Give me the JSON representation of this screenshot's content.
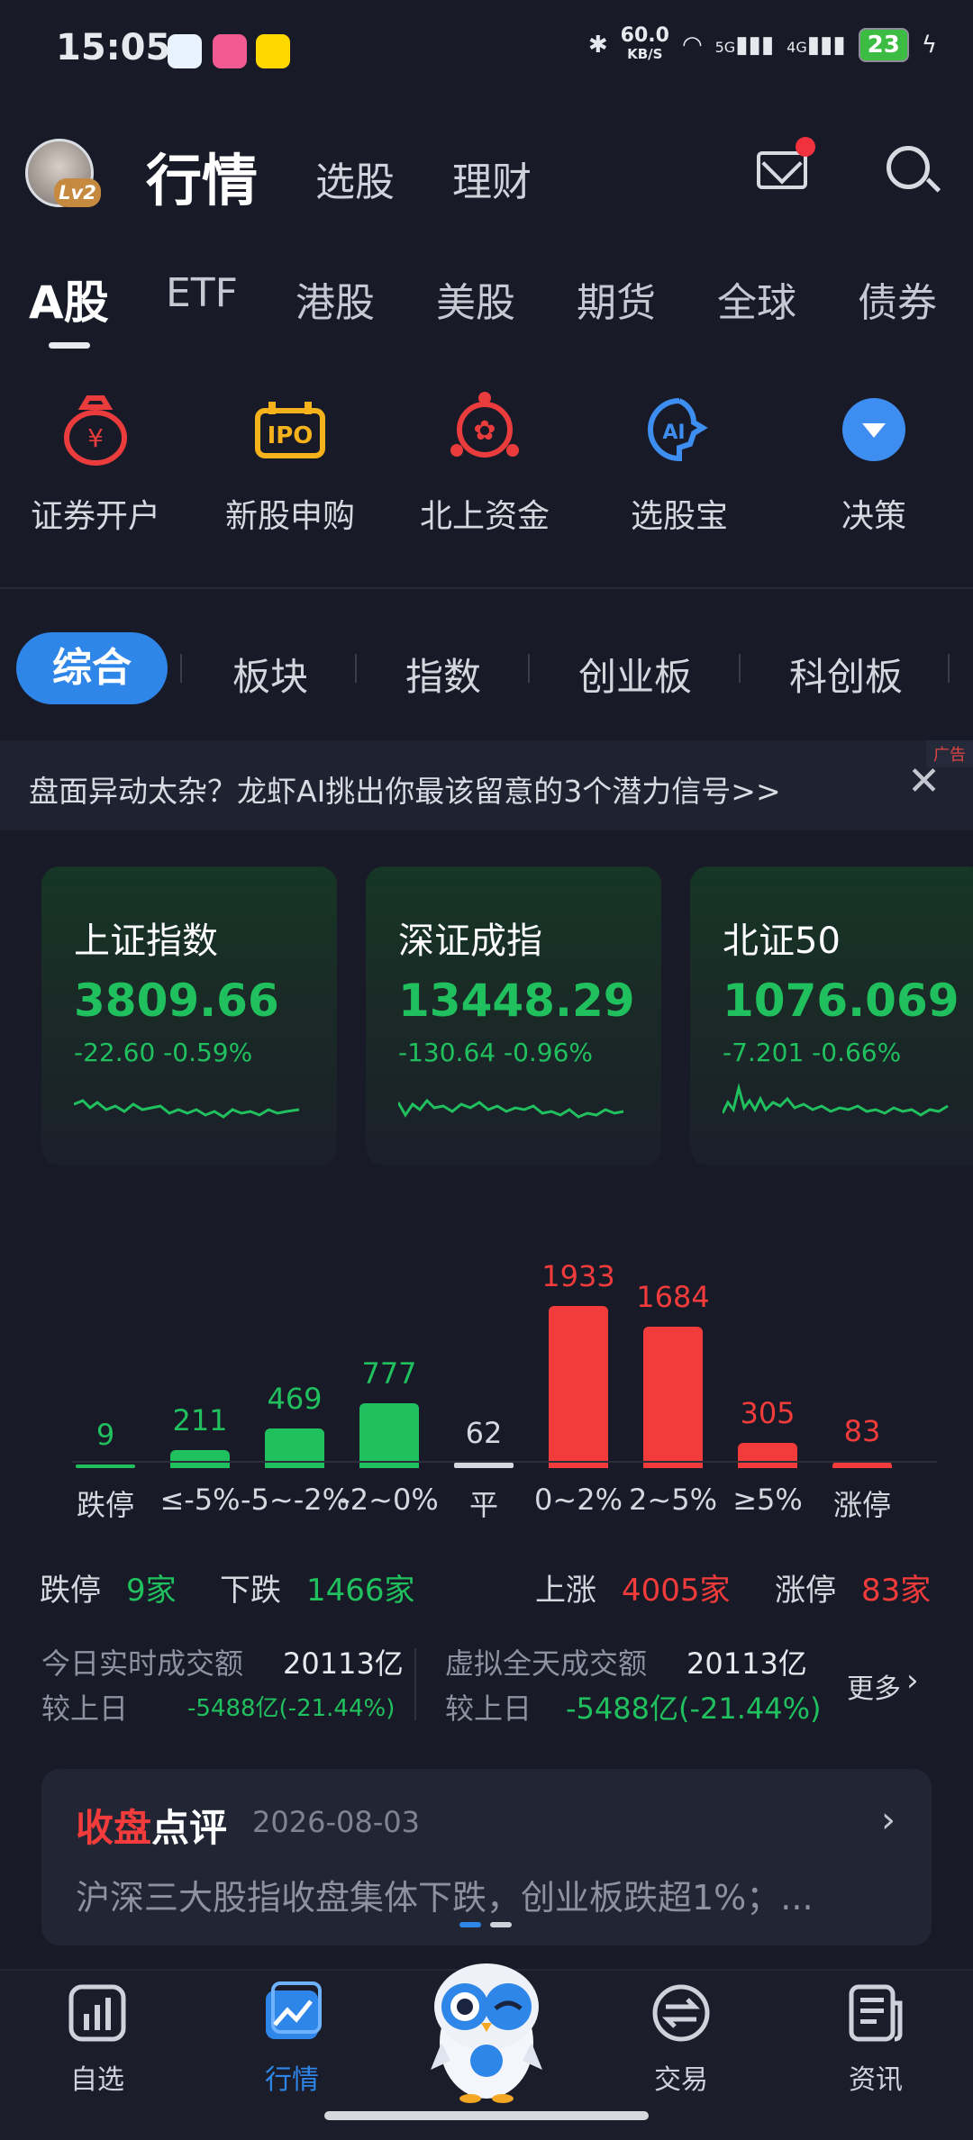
{
  "status": {
    "time": "15:05",
    "net_speed": "60.0",
    "net_unit": "KB/S",
    "net1": "5G",
    "net2": "4G",
    "battery": "23"
  },
  "header": {
    "avatar_level": "Lv2",
    "nav_active": "行情",
    "nav_items": [
      "选股",
      "理财"
    ]
  },
  "market_tabs": [
    "A股",
    "ETF",
    "港股",
    "美股",
    "期货",
    "全球",
    "债券"
  ],
  "quick": [
    {
      "label": "证券开户",
      "icon": "bag-yen-icon"
    },
    {
      "label": "新股申购",
      "icon": "ipo-icon"
    },
    {
      "label": "北上资金",
      "icon": "hk-flag-icon"
    },
    {
      "label": "选股宝",
      "icon": "ai-head-icon"
    },
    {
      "label": "决策",
      "icon": "chevron-circle-icon"
    }
  ],
  "segments": [
    "综合",
    "板块",
    "指数",
    "创业板",
    "科创板"
  ],
  "ad": {
    "text": "盘面异动太杂？龙虾AI挑出你最该留意的3个潜力信号>>",
    "tag": "广告"
  },
  "indices": [
    {
      "name": "上证指数",
      "value": "3809.66",
      "change": "-22.60 -0.59%"
    },
    {
      "name": "深证成指",
      "value": "13448.29",
      "change": "-130.64 -0.96%"
    },
    {
      "name": "北证50",
      "value": "1076.069",
      "change": "-7.201 -0.66%"
    }
  ],
  "chart_data": {
    "type": "bar",
    "categories": [
      "跌停",
      "≤-5%",
      "-5~-2%",
      "-2~0%",
      "平",
      "0~2%",
      "2~5%",
      "≥5%",
      "涨停"
    ],
    "values": [
      9,
      211,
      469,
      777,
      62,
      1933,
      1684,
      305,
      83
    ],
    "colors": [
      "#21c05f",
      "#21c05f",
      "#21c05f",
      "#21c05f",
      "#d5d8de",
      "#f23b3b",
      "#f23b3b",
      "#f23b3b",
      "#f23b3b"
    ]
  },
  "stats": {
    "limit_down_label": "跌停",
    "limit_down": "9家",
    "down_label": "下跌",
    "down": "1466家",
    "up_label": "上涨",
    "up": "4005家",
    "limit_up_label": "涨停",
    "limit_up": "83家"
  },
  "turnover": {
    "today_label": "今日实时成交额",
    "today": "20113亿",
    "prev_label": "较上日",
    "prev": "-5488亿(-21.44%)",
    "virtual_label": "虚拟全天成交额",
    "virtual": "20113亿",
    "vprev_label": "较上日",
    "vprev": "-5488亿(-21.44%)",
    "more": "更多"
  },
  "review": {
    "title_red": "收盘",
    "title_white": "点评",
    "date": "2026-08-03",
    "text": "沪深三大股指收盘集体下跌，创业板跌超1%；..."
  },
  "tabbar": [
    "自选",
    "行情",
    "交易",
    "资讯"
  ]
}
